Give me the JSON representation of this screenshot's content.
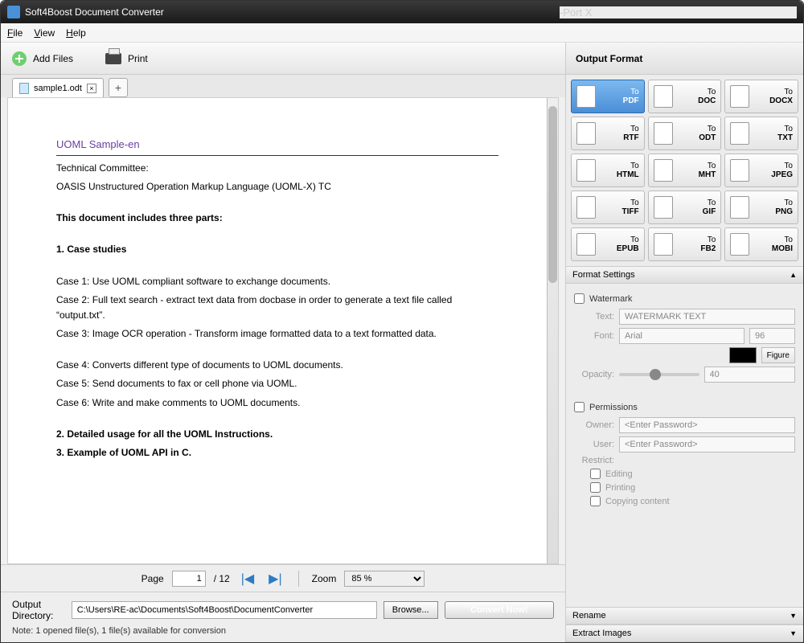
{
  "title": "Soft4Boost Document Converter",
  "port": "-Port X",
  "menu": {
    "file": "File",
    "view": "View",
    "help": "Help"
  },
  "toolbar": {
    "add": "Add Files",
    "print": "Print"
  },
  "tab": {
    "name": "sample1.odt"
  },
  "document": {
    "title": "UOML Sample-en",
    "committee": "Technical Committee:",
    "tc": "OASIS Unstructured Operation Markup Language (UOML-X) TC",
    "parts": "This document includes three parts:",
    "s1": "1.      Case studies",
    "c1": "Case 1: Use UOML compliant software  to exchange documents.",
    "c2": "Case 2: Full text search - extract text data from docbase in order to generate a text file called “output.txt”.",
    "c3": "Case 3: Image OCR operation - Transform image formatted data to a text formatted data.",
    "c4": "Case 4: Converts different type of documents to UOML documents.",
    "c5": "Case 5: Send documents to fax or cell phone via UOML.",
    "c6": "Case 6: Write and make comments to UOML documents.",
    "s2": "2.      Detailed usage for all the UOML Instructions.",
    "s3": "3.      Example of UOML API in C."
  },
  "pager": {
    "pagelbl": "Page",
    "page": "1",
    "total": "/ 12",
    "zoomlbl": "Zoom",
    "zoom": "85 %"
  },
  "output": {
    "dirlbl": "Output Directory:",
    "dir": "C:\\Users\\RE-ac\\Documents\\Soft4Boost\\DocumentConverter",
    "browse": "Browse...",
    "note": "Note: 1 opened file(s), 1 file(s) available for conversion",
    "convert": "Convert Now!"
  },
  "panel": {
    "title": "Output Format",
    "to": "To"
  },
  "formats": [
    "PDF",
    "DOC",
    "DOCX",
    "RTF",
    "ODT",
    "TXT",
    "HTML",
    "MHT",
    "JPEG",
    "TIFF",
    "GIF",
    "PNG",
    "EPUB",
    "FB2",
    "MOBI"
  ],
  "settings_title": "Format Settings",
  "watermark": {
    "label": "Watermark",
    "textlbl": "Text:",
    "text": "WATERMARK TEXT",
    "fontlbl": "Font:",
    "font": "Arial",
    "size": "96",
    "figure": "Figure",
    "opacitylbl": "Opacity:",
    "opacity": "40"
  },
  "permissions": {
    "label": "Permissions",
    "ownerlbl": "Owner:",
    "owner": "<Enter Password>",
    "userlbl": "User:",
    "user": "<Enter Password>",
    "restrictlbl": "Restrict:",
    "editing": "Editing",
    "printing": "Printing",
    "copying": "Copying content"
  },
  "rename": "Rename",
  "extract": "Extract Images"
}
